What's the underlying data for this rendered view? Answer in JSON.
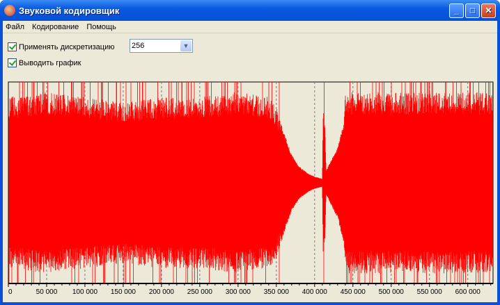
{
  "window": {
    "title": "Звуковой кодировщик",
    "buttons": [
      "minimize",
      "maximize",
      "close"
    ]
  },
  "menu": [
    "Файл",
    "Кодирование",
    "Помощь"
  ],
  "options": {
    "apply_sampling_label": "Применять дискретизацию",
    "apply_sampling_checked": true,
    "show_graph_label": "Выводить график",
    "show_graph_checked": true,
    "sampling_value": "256"
  },
  "chart_data": {
    "type": "area",
    "description_series": "waveform envelope (normalized amplitude)",
    "xlim": [
      0,
      633000
    ],
    "ylim": [
      -1,
      1
    ],
    "x_ticks": [
      0,
      50000,
      100000,
      150000,
      200000,
      250000,
      300000,
      350000,
      400000,
      450000,
      500000,
      550000,
      600000
    ],
    "x_tick_labels": [
      "0",
      "50 000",
      "100 000",
      "150 000",
      "200 000",
      "250 000",
      "300 000",
      "350 000",
      "400 000",
      "450 000",
      "500 000",
      "550 000",
      "600 000"
    ],
    "grid": "vertical dashed at major ticks",
    "color": "#ff0000",
    "envelope": {
      "x": [
        0,
        50000,
        100000,
        150000,
        200000,
        250000,
        300000,
        340000,
        350000,
        360000,
        370000,
        380000,
        390000,
        400000,
        410000,
        411000,
        413000,
        415000,
        420000,
        430000,
        438000,
        440000,
        500000,
        550000,
        600000,
        633000
      ],
      "amp": [
        0.85,
        0.9,
        0.85,
        0.8,
        0.85,
        0.85,
        0.9,
        0.85,
        0.75,
        0.5,
        0.28,
        0.16,
        0.1,
        0.06,
        0.04,
        0.7,
        0.7,
        0.12,
        0.2,
        0.35,
        0.6,
        0.9,
        0.9,
        0.9,
        0.9,
        0.9
      ]
    }
  }
}
